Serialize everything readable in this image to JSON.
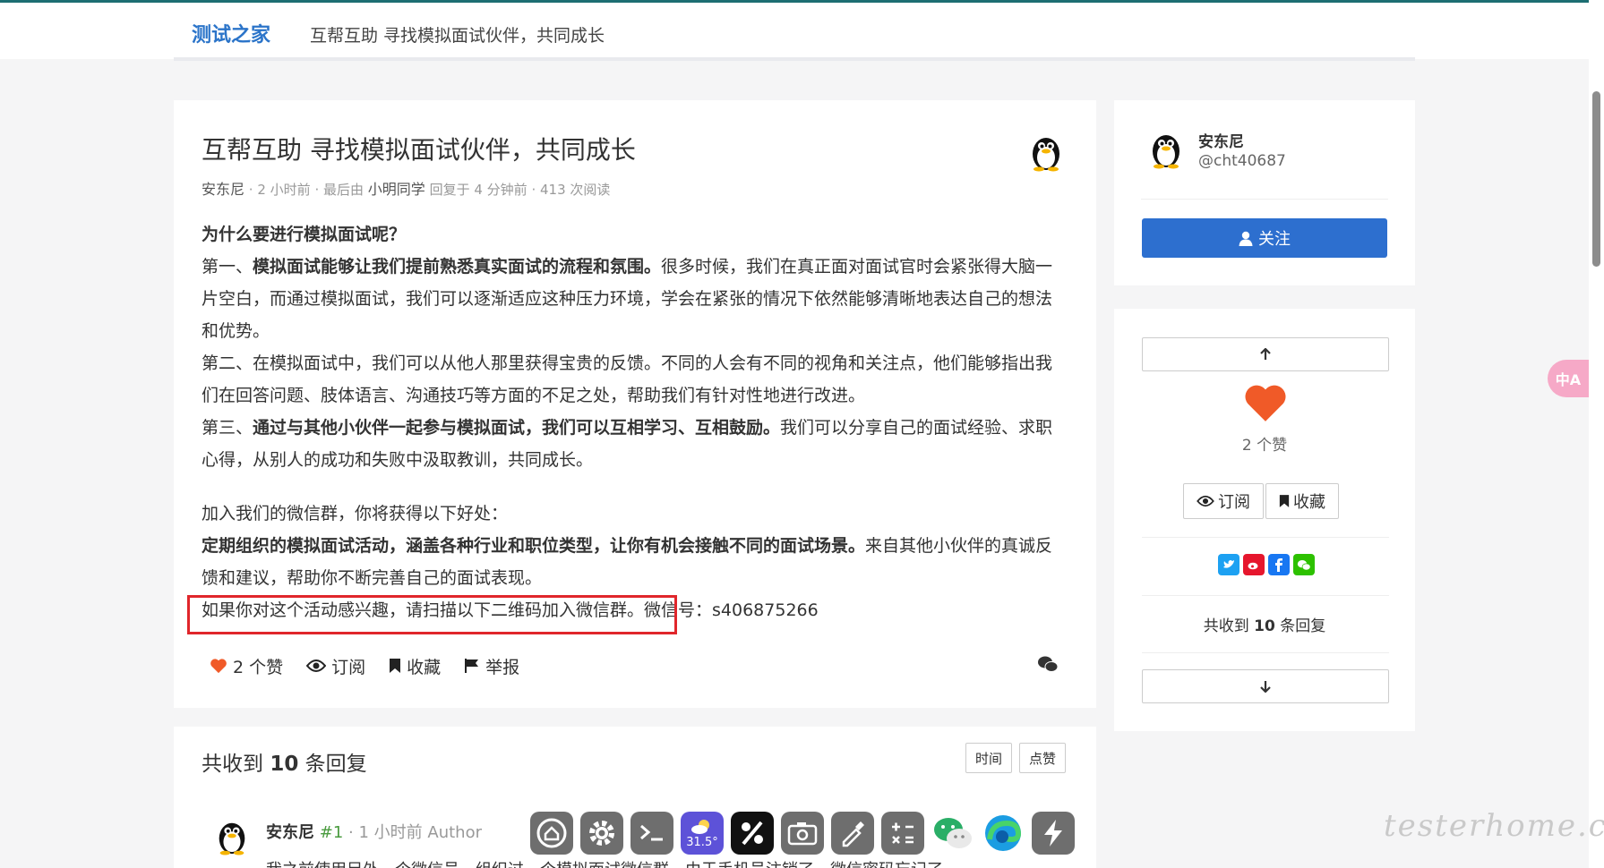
{
  "header": {
    "brand": "测试之家",
    "title": "互帮互助 寻找模拟面试伙伴，共同成长"
  },
  "post": {
    "title": "互帮互助 寻找模拟面试伙伴，共同成长",
    "author": "安东尼",
    "time": "2 小时前",
    "last_by_prefix": "最后由",
    "last_user": "小明同学",
    "replied": "回复于 4 分钟前",
    "reads": "413 次阅读",
    "body": {
      "q": "为什么要进行模拟面试呢？",
      "p1_pre": "第一、",
      "p1_bold": "模拟面试能够让我们提前熟悉真实面试的流程和氛围。",
      "p1_rest": "很多时候，我们在真正面对面试官时会紧张得大脑一片空白，而通过模拟面试，我们可以逐渐适应这种压力环境，学会在紧张的情况下依然能够清晰地表达自己的想法和优势。",
      "p2": "第二、在模拟面试中，我们可以从他人那里获得宝贵的反馈。不同的人会有不同的视角和关注点，他们能够指出我们在回答问题、肢体语言、沟通技巧等方面的不足之处，帮助我们有针对性地进行改进。",
      "p3_pre": "第三、",
      "p3_bold": "通过与其他小伙伴一起参与模拟面试，我们可以互相学习、互相鼓励。",
      "p3_rest": "我们可以分享自己的面试经验、求职心得，从别人的成功和失败中汲取教训，共同成长。",
      "join": "加入我们的微信群，你将获得以下好处：",
      "benefit_bold": "定期组织的模拟面试活动，涵盖各种行业和职位类型，让你有机会接触不同的面试场景。",
      "benefit_rest": "来自其他小伙伴的真诚反馈和建议，帮助你不断完善自己的面试表现。",
      "cta": "如果你对这个活动感兴趣，请扫描以下二维码加入微信群。",
      "wechat": "微信号：s406875266"
    },
    "actions": {
      "likes": "2 个赞",
      "subscribe": "订阅",
      "favorite": "收藏",
      "report": "举报"
    }
  },
  "profile": {
    "name": "安东尼",
    "handle": "@cht40687",
    "follow": "关注"
  },
  "sidebar_actions": {
    "likes": "2 个赞",
    "subscribe": "订阅",
    "favorite": "收藏",
    "reply_prefix": "共收到",
    "reply_count": "10",
    "reply_suffix": "条回复"
  },
  "replies": {
    "prefix": "共收到",
    "count": "10",
    "suffix": "条回复",
    "sort_time": "时间",
    "sort_likes": "点赞",
    "first": {
      "name": "安东尼",
      "floor": "#1",
      "time": "· 1 小时前",
      "role": "Author",
      "snippet": "我之前使用另外一个微信号，组织过一个模拟面试微信群，由于手机号注销了，微信密码忘记了"
    }
  },
  "taskbar": {
    "weather_temp": "31.5°"
  },
  "watermark": "testerhome.com",
  "translate_label": "中A",
  "colors": {
    "brand": "#2b74c9",
    "follow_button": "#2d6fcf",
    "heart": "#f05a28",
    "highlight_border": "#e0262b"
  }
}
